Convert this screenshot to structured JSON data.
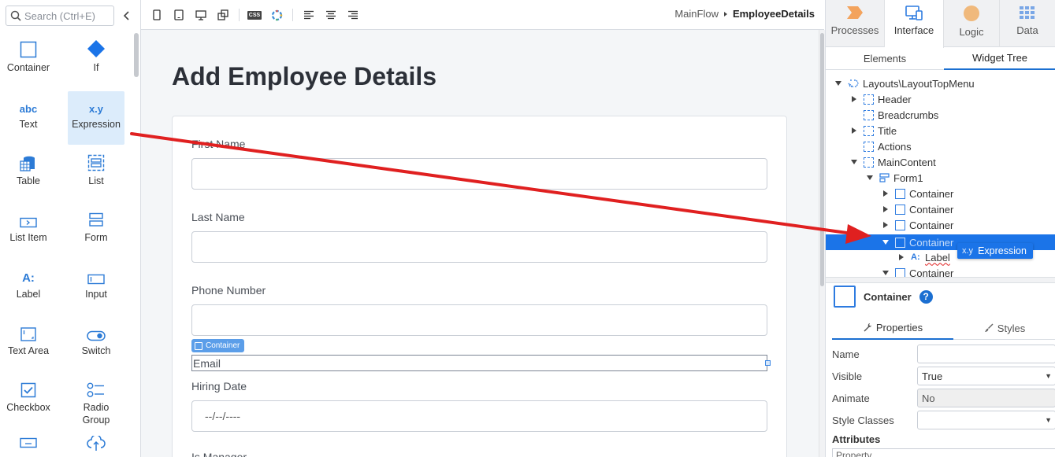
{
  "toolbox": {
    "search_placeholder": "Search (Ctrl+E)",
    "items": [
      {
        "label": "Container",
        "icon": "container-icon"
      },
      {
        "label": "If",
        "icon": "diamond-icon"
      },
      {
        "label": "Text",
        "icon": "abc-text-icon",
        "glyph": "abc"
      },
      {
        "label": "Expression",
        "icon": "expression-icon",
        "glyph": "x.y"
      },
      {
        "label": "Table",
        "icon": "table-icon"
      },
      {
        "label": "List",
        "icon": "list-icon"
      },
      {
        "label": "List Item",
        "icon": "list-item-icon"
      },
      {
        "label": "Form",
        "icon": "form-icon"
      },
      {
        "label": "Label",
        "icon": "label-icon",
        "glyph": "A:"
      },
      {
        "label": "Input",
        "icon": "input-icon"
      },
      {
        "label": "Text Area",
        "icon": "text-area-icon"
      },
      {
        "label": "Switch",
        "icon": "switch-icon"
      },
      {
        "label": "Checkbox",
        "icon": "checkbox-icon"
      },
      {
        "label": "Radio Group",
        "icon": "radio-group-icon"
      }
    ]
  },
  "toolbar": {
    "css_label": "CSS",
    "breadcrumb": {
      "flow": "MainFlow",
      "screen": "EmployeeDetails"
    }
  },
  "canvas": {
    "title": "Add Employee Details",
    "fields": [
      {
        "label": "First Name"
      },
      {
        "label": "Last Name"
      },
      {
        "label": "Phone Number"
      },
      {
        "label": "Hiring Date",
        "value": "--/--/----"
      }
    ],
    "container_tag": "Container",
    "email_label": "Email",
    "partial_label": "Is Manager"
  },
  "right_panel": {
    "tabs": [
      {
        "label": "Processes",
        "icon": "processes-icon"
      },
      {
        "label": "Interface",
        "icon": "interface-icon"
      },
      {
        "label": "Logic",
        "icon": "logic-icon"
      },
      {
        "label": "Data",
        "icon": "data-icon"
      }
    ],
    "subtabs": [
      "Elements",
      "Widget Tree"
    ],
    "tree": [
      {
        "label": "Layouts\\LayoutTopMenu"
      },
      {
        "label": "Header"
      },
      {
        "label": "Breadcrumbs"
      },
      {
        "label": "Title"
      },
      {
        "label": "Actions"
      },
      {
        "label": "MainContent"
      },
      {
        "label": "Form1"
      },
      {
        "label": "Container"
      },
      {
        "label": "Container"
      },
      {
        "label": "Container"
      },
      {
        "label": "Container"
      },
      {
        "label": "Label"
      },
      {
        "label": "Container"
      }
    ],
    "drag_ghost": {
      "glyph": "x.y",
      "label": "Expression"
    },
    "selected": {
      "name": "Container",
      "help": "?"
    },
    "prop_tabs": [
      "Properties",
      "Styles"
    ],
    "properties": [
      {
        "label": "Name",
        "value": ""
      },
      {
        "label": "Visible",
        "value": "True"
      },
      {
        "label": "Animate",
        "value": "No"
      },
      {
        "label": "Style Classes",
        "value": ""
      }
    ],
    "attributes_label": "Attributes",
    "attributes_col": "Property"
  },
  "colors": {
    "accent": "#1b74e8",
    "arrow": "#e02020"
  }
}
